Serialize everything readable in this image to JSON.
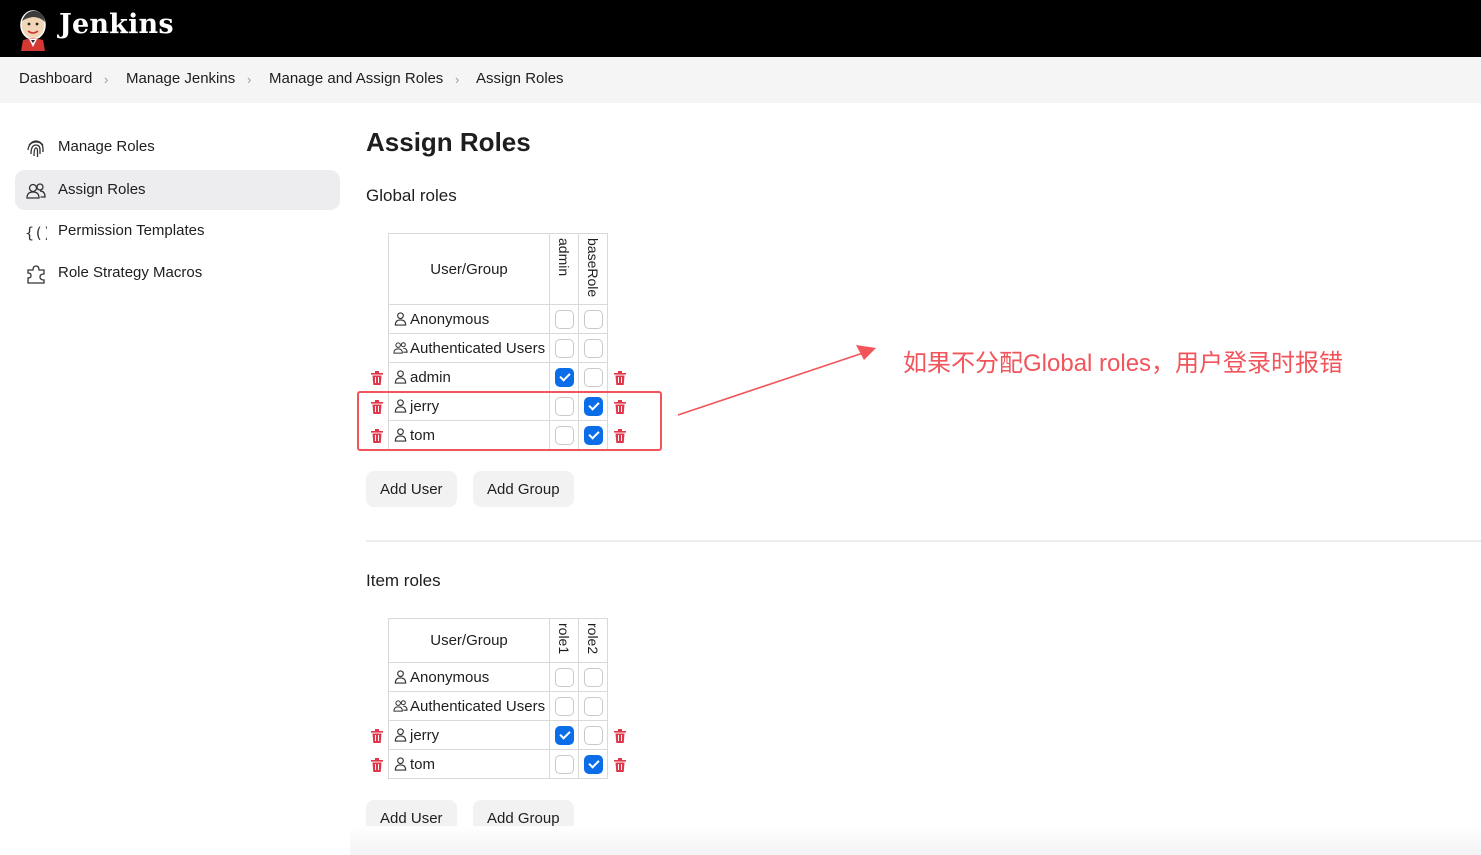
{
  "app": {
    "name": "Jenkins"
  },
  "breadcrumb": [
    "Dashboard",
    "Manage Jenkins",
    "Manage and Assign Roles",
    "Assign Roles"
  ],
  "sidebar": {
    "items": [
      {
        "label": "Manage Roles",
        "icon": "fingerprint-icon",
        "active": false
      },
      {
        "label": "Assign Roles",
        "icon": "users-icon",
        "active": true
      },
      {
        "label": "Permission Templates",
        "icon": "braces-icon",
        "active": false
      },
      {
        "label": "Role Strategy Macros",
        "icon": "puzzle-icon",
        "active": false
      }
    ]
  },
  "page_title": "Assign Roles",
  "global": {
    "heading": "Global roles",
    "column_header": "User/Group",
    "roles": [
      "admin",
      "baseRole"
    ],
    "rows": [
      {
        "name": "Anonymous",
        "icon": "user-icon",
        "checked": [
          false,
          false
        ],
        "deletable": false
      },
      {
        "name": "Authenticated Users",
        "icon": "group-icon",
        "checked": [
          false,
          false
        ],
        "deletable": false
      },
      {
        "name": "admin",
        "icon": "user-icon",
        "checked": [
          true,
          false
        ],
        "deletable": true
      },
      {
        "name": "jerry",
        "icon": "user-icon",
        "checked": [
          false,
          true
        ],
        "deletable": true
      },
      {
        "name": "tom",
        "icon": "user-icon",
        "checked": [
          false,
          true
        ],
        "deletable": true
      }
    ],
    "add_user": "Add User",
    "add_group": "Add Group"
  },
  "item": {
    "heading": "Item roles",
    "column_header": "User/Group",
    "roles": [
      "role1",
      "role2"
    ],
    "rows": [
      {
        "name": "Anonymous",
        "icon": "user-icon",
        "checked": [
          false,
          false
        ],
        "deletable": false
      },
      {
        "name": "Authenticated Users",
        "icon": "group-icon",
        "checked": [
          false,
          false
        ],
        "deletable": false
      },
      {
        "name": "jerry",
        "icon": "user-icon",
        "checked": [
          true,
          false
        ],
        "deletable": true
      },
      {
        "name": "tom",
        "icon": "user-icon",
        "checked": [
          false,
          true
        ],
        "deletable": true
      }
    ],
    "add_user": "Add User",
    "add_group": "Add Group"
  },
  "annotation": {
    "text": "如果不分配Global roles，用户登录时报错",
    "color": "#f2545b"
  },
  "colors": {
    "accent": "#0b6ee8",
    "danger": "#e0364a",
    "header_bg": "#000000"
  }
}
